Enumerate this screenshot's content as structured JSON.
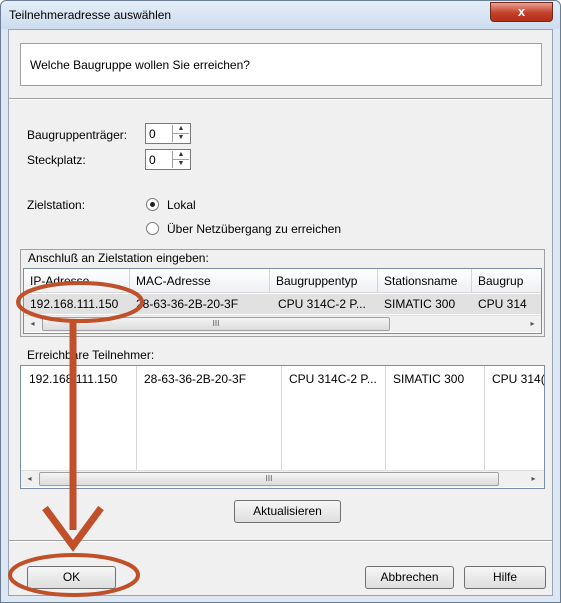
{
  "window": {
    "title": "Teilnehmeradresse auswählen",
    "close_glyph": "x"
  },
  "question": "Welche Baugruppe wollen Sie erreichen?",
  "rack": {
    "label": "Baugruppenträger:",
    "value": "0"
  },
  "slot": {
    "label": "Steckplatz:",
    "value": "0"
  },
  "target": {
    "label": "Zielstation:",
    "options": [
      {
        "label": "Lokal",
        "checked": true
      },
      {
        "label": "Über Netzübergang zu erreichen",
        "checked": false
      }
    ]
  },
  "connection": {
    "title": "Anschluß an Zielstation eingeben:",
    "columns": [
      "IP-Adresse",
      "MAC-Adresse",
      "Baugruppentyp",
      "Stationsname",
      "Baugrup"
    ],
    "row": [
      "192.168.111.150",
      "28-63-36-2B-20-3F",
      "CPU 314C-2 P...",
      "SIMATIC 300",
      "CPU 314"
    ]
  },
  "reachable": {
    "title": "Erreichbare Teilnehmer:",
    "row": [
      "192.168.111.150",
      "28-63-36-2B-20-3F",
      "CPU 314C-2 P...",
      "SIMATIC 300",
      "CPU 314("
    ]
  },
  "scroll": {
    "left": "◂",
    "right": "▸",
    "thumb": "III"
  },
  "spin_arrows": {
    "up": "▲",
    "down": "▼"
  },
  "buttons": {
    "refresh": "Aktualisieren",
    "ok": "OK",
    "cancel": "Abbrechen",
    "help": "Hilfe"
  },
  "colors": {
    "annotation": "#c0502a"
  }
}
